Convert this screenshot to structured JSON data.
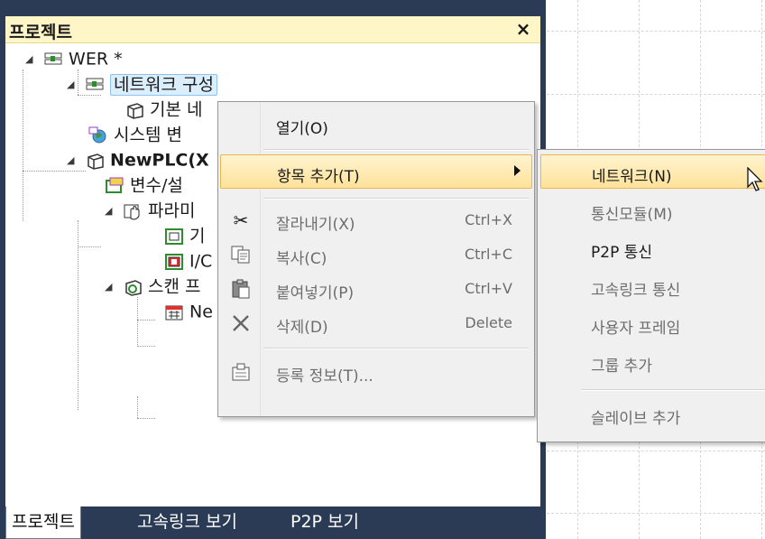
{
  "panel": {
    "title": "프로젝트",
    "close": "×"
  },
  "tree": {
    "root": "WER *",
    "network": "네트워크 구성",
    "basic": "기본 네",
    "sysvar": "시스템 변",
    "plc": "NewPLC(X",
    "vars": "변수/설",
    "params": "파라미",
    "param1": "기",
    "param2": "I/C",
    "scan": "스캔 프",
    "prog": "Ne"
  },
  "tabs": [
    "프로젝트",
    "고속링크 보기",
    "P2P 보기"
  ],
  "context_menu": {
    "open": "열기(O)",
    "add_item": "항목 추가(T)",
    "cut": "잘라내기(X)",
    "cut_shortcut": "Ctrl+X",
    "copy": "복사(C)",
    "copy_shortcut": "Ctrl+C",
    "paste": "붙여넣기(P)",
    "paste_shortcut": "Ctrl+V",
    "delete": "삭제(D)",
    "delete_shortcut": "Delete",
    "properties": "등록 정보(T)..."
  },
  "submenu": {
    "network": "네트워크(N)",
    "comm_module": "통신모듈(M)",
    "p2p": "P2P 통신",
    "highspeed": "고속링크 통신",
    "user_frame": "사용자 프레임",
    "add_group": "그룹 추가",
    "add_slave": "슬레이브 추가"
  },
  "colors": {
    "panel_frame": "#2b3a55",
    "title_bg": "#fff6c8",
    "highlight": "#ffe29a"
  }
}
